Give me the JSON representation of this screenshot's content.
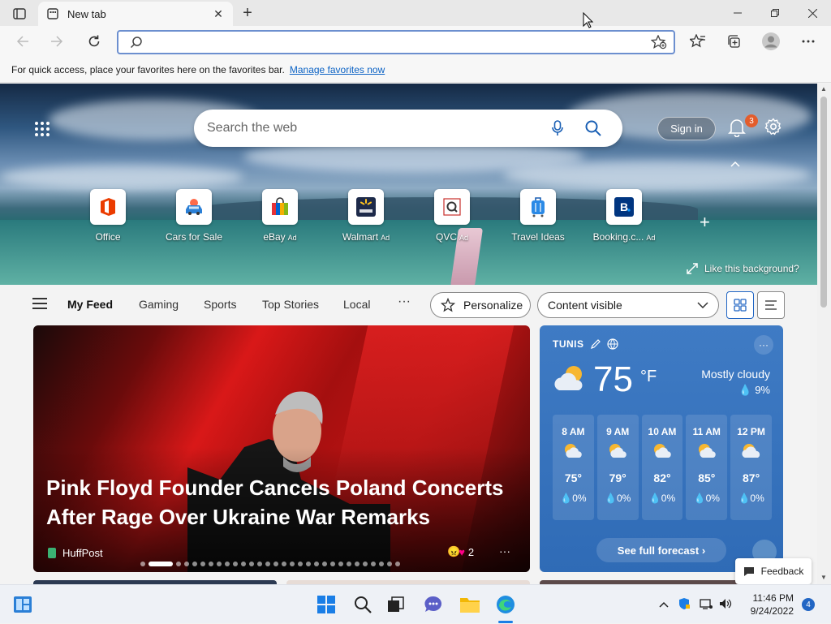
{
  "browser": {
    "tab_title": "New tab",
    "address_placeholder": "",
    "favorites_bar_text": "For quick access, place your favorites here on the favorites bar.",
    "favorites_bar_link": "Manage favorites now"
  },
  "newtab": {
    "search_placeholder": "Search the web",
    "sign_in_label": "Sign in",
    "notification_count": "3",
    "like_background_label": "Like this background?",
    "quick_links": [
      {
        "name": "Office",
        "ad": ""
      },
      {
        "name": "Cars for Sale",
        "ad": ""
      },
      {
        "name": "eBay",
        "ad": "Ad"
      },
      {
        "name": "Walmart",
        "ad": "Ad"
      },
      {
        "name": "QVC",
        "ad": "Ad"
      },
      {
        "name": "Travel Ideas",
        "ad": ""
      },
      {
        "name": "Booking.c...",
        "ad": "Ad"
      }
    ]
  },
  "feed": {
    "tabs": [
      "My Feed",
      "Gaming",
      "Sports",
      "Top Stories",
      "Local"
    ],
    "more_label": "···",
    "personalize_label": "Personalize",
    "content_select_value": "Content visible"
  },
  "headline_card": {
    "title": "Pink Floyd Founder Cancels Poland Concerts After Rage Over Ukraine War Remarks",
    "source": "HuffPost",
    "reaction_count": "2",
    "carousel_total": 30,
    "carousel_current": 1
  },
  "weather": {
    "location": "TUNIS",
    "temperature": "75",
    "unit": "°F",
    "condition": "Mostly cloudy",
    "precip": "9%",
    "hourly": [
      {
        "time": "8 AM",
        "temp": "75°",
        "precip": "0%"
      },
      {
        "time": "9 AM",
        "temp": "79°",
        "precip": "0%"
      },
      {
        "time": "10 AM",
        "temp": "82°",
        "precip": "0%"
      },
      {
        "time": "11 AM",
        "temp": "85°",
        "precip": "0%"
      },
      {
        "time": "12 PM",
        "temp": "87°",
        "precip": "0%"
      }
    ],
    "forecast_button": "See full forecast"
  },
  "feedback_label": "Feedback",
  "taskbar": {
    "time": "11:46 PM",
    "date": "9/24/2022",
    "notification_count": "4"
  },
  "colors": {
    "accent": "#2266c4",
    "weather_bg": "#3f7bc4",
    "badge": "#e35d2c"
  }
}
